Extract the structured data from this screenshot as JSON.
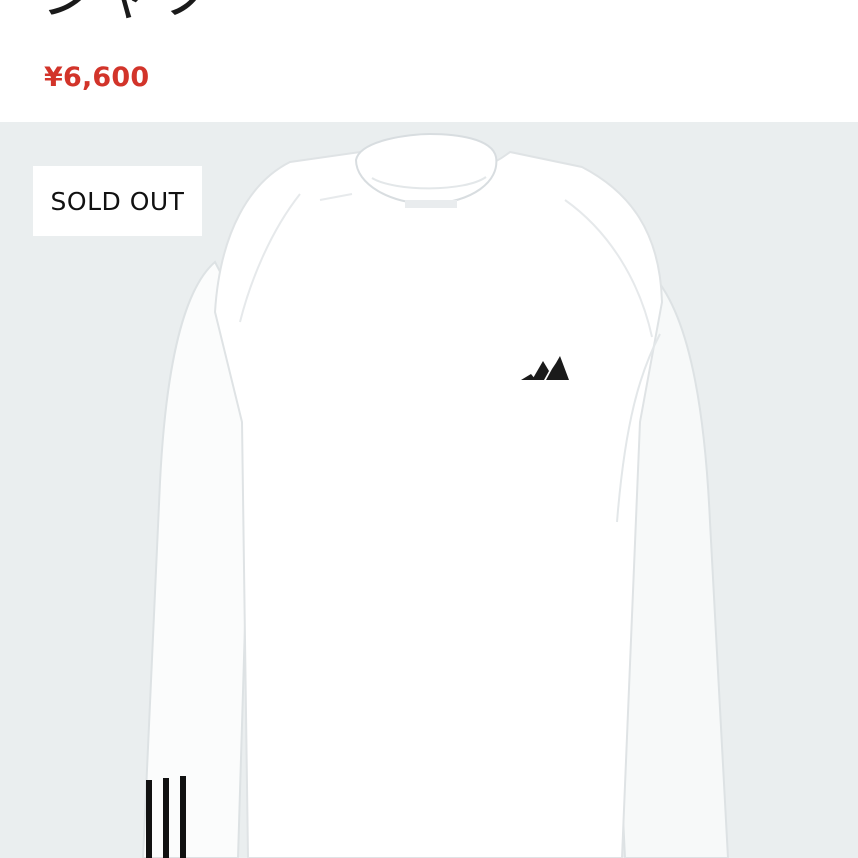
{
  "product": {
    "title": "シャツ",
    "price": "¥6,600",
    "status_badge": "SOLD OUT",
    "image_icon": "long-sleeve-shirt-image",
    "logo_icon": "adidas-logo-icon"
  },
  "colors": {
    "price": "#d2342a",
    "image_background": "#eaeeef",
    "badge_background": "#ffffff",
    "badge_text": "#111111"
  }
}
